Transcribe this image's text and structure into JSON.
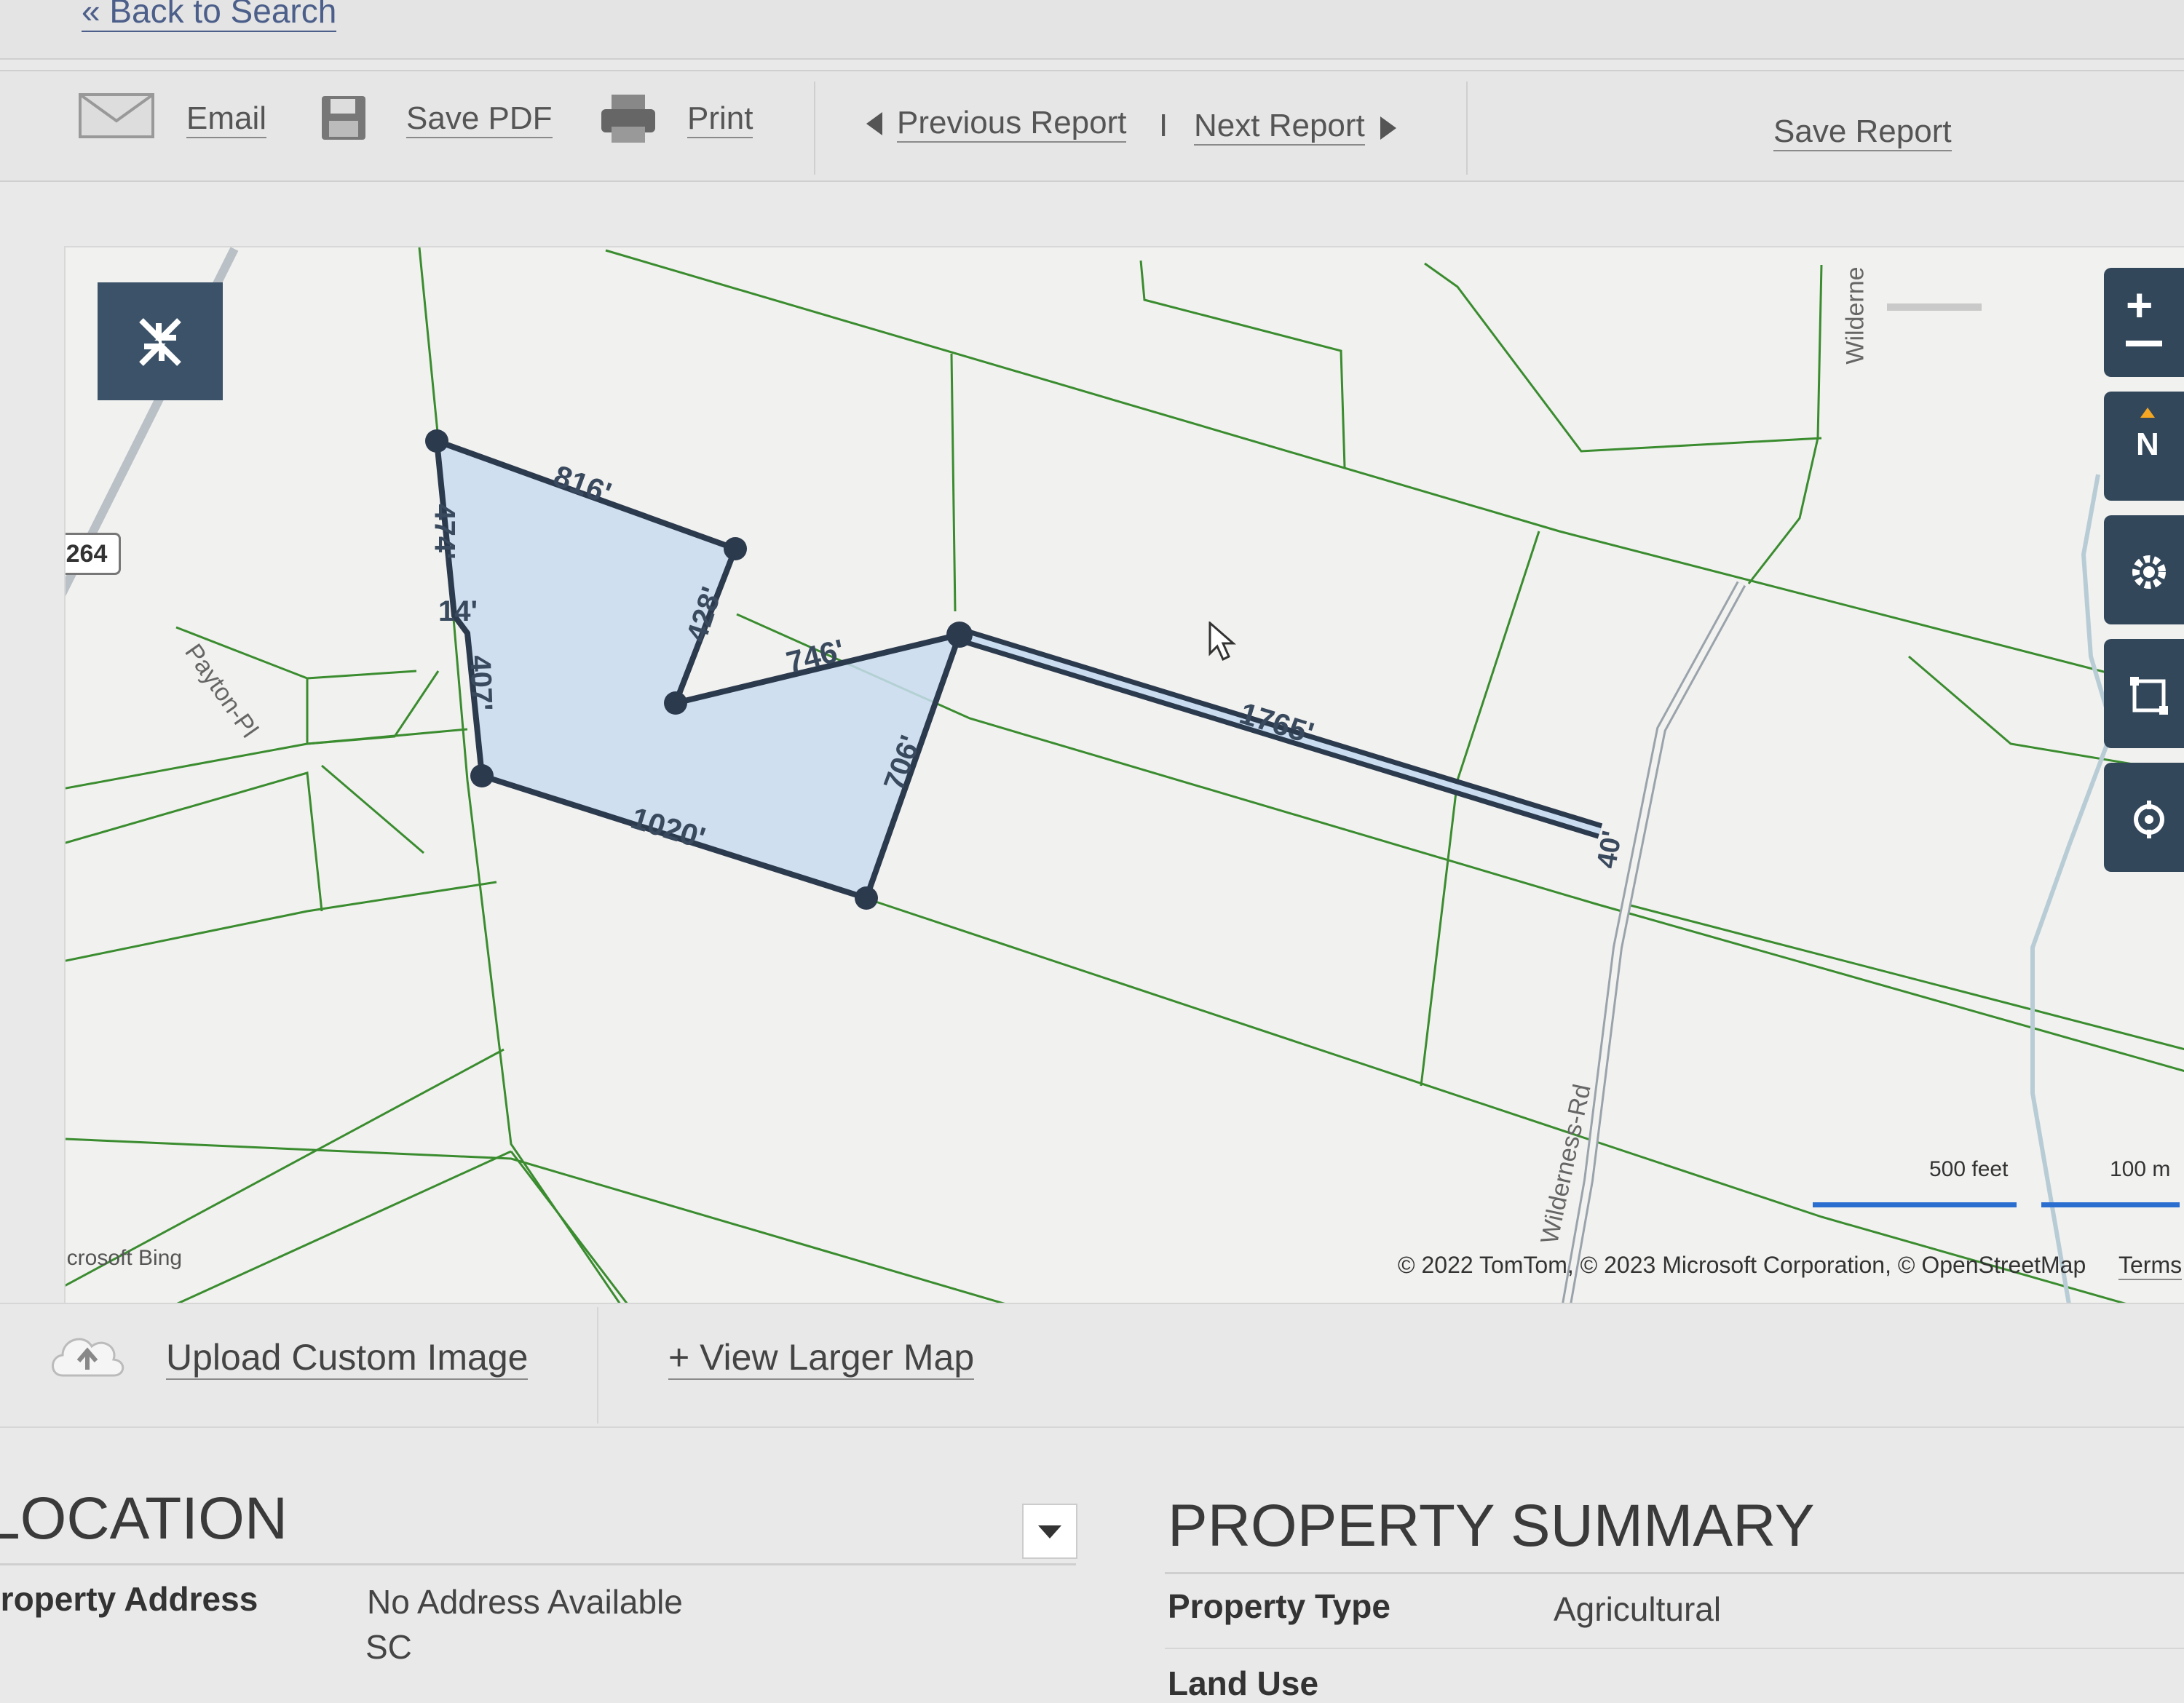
{
  "nav": {
    "back_label": "« Back to Search"
  },
  "toolbar": {
    "email_label": "Email",
    "save_pdf_label": "Save PDF",
    "print_label": "Print",
    "prev_label": "Previous Report",
    "divider": "I",
    "next_label": "Next Report",
    "save_report_label": "Save Report"
  },
  "map": {
    "route_shield": "264",
    "street_payton": "Payton-Pl",
    "street_wilderness": "Wilderness-Rd",
    "street_wilderness_top": "Wilderne",
    "dimensions": {
      "top": "816'",
      "left_upper": "474'",
      "jog": "14'",
      "left_lower": "407'",
      "inner_right": "428'",
      "inner_diag": "746'",
      "bottom": "1020'",
      "right": "706'",
      "strip": "1765'",
      "strip_end": "40'"
    },
    "scale_feet": "500 feet",
    "scale_m": "100 m",
    "attribution_brand": "Microsoft Bing",
    "copyright": "© 2022 TomTom, © 2023 Microsoft Corporation, © OpenStreetMap",
    "terms": "Terms",
    "compass": "N",
    "icons": [
      "collapse-icon",
      "zoom-in-icon",
      "zoom-out-icon",
      "compass-icon",
      "settings-icon",
      "draw-rectangle-icon",
      "locate-icon",
      "cursor-icon"
    ],
    "parcel_fill": "#c9dcf0",
    "parcel_stroke": "#2c3a4e",
    "lot_line_color": "#3a8c2f"
  },
  "actions": {
    "upload_label": "Upload Custom Image",
    "view_larger_label": "+ View Larger Map"
  },
  "location": {
    "title": "LOCATION",
    "address_label": "Property Address",
    "address_line1": "No Address Available",
    "address_line2": "SC"
  },
  "summary": {
    "title": "PROPERTY SUMMARY",
    "type_label": "Property Type",
    "type_value": "Agricultural",
    "land_use_label": "Land Use"
  }
}
